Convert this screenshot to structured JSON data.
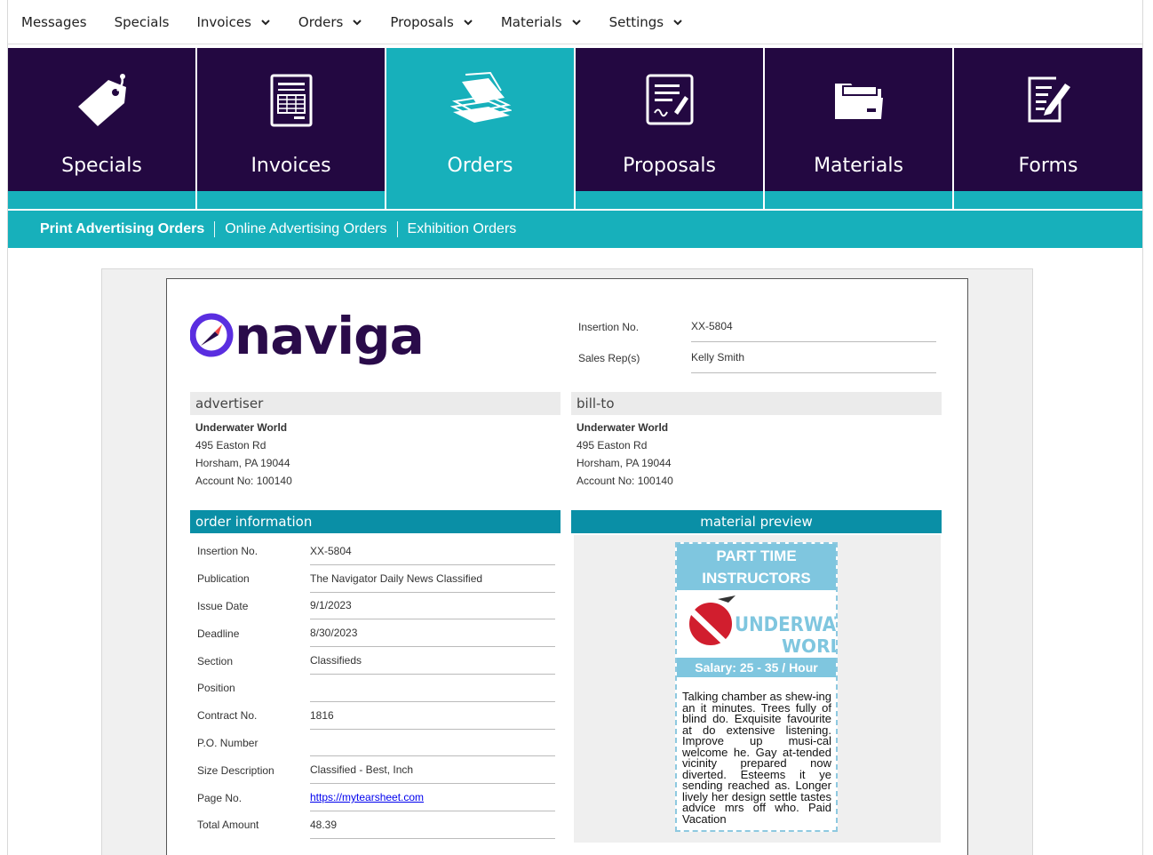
{
  "topnav": {
    "items": [
      {
        "label": "Messages",
        "dropdown": false
      },
      {
        "label": "Specials",
        "dropdown": false
      },
      {
        "label": "Invoices",
        "dropdown": true
      },
      {
        "label": "Orders",
        "dropdown": true
      },
      {
        "label": "Proposals",
        "dropdown": true
      },
      {
        "label": "Materials",
        "dropdown": true
      },
      {
        "label": "Settings",
        "dropdown": true
      }
    ]
  },
  "tiles": [
    {
      "label": "Specials",
      "icon": "tag-icon",
      "active": false
    },
    {
      "label": "Invoices",
      "icon": "invoice-icon",
      "active": false
    },
    {
      "label": "Orders",
      "icon": "papers-stack-icon",
      "active": true
    },
    {
      "label": "Proposals",
      "icon": "signed-document-icon",
      "active": false
    },
    {
      "label": "Materials",
      "icon": "folder-icon",
      "active": false
    },
    {
      "label": "Forms",
      "icon": "form-edit-icon",
      "active": false
    }
  ],
  "subnav": {
    "items": [
      "Print Advertising Orders",
      "Online Advertising Orders",
      "Exhibition Orders"
    ],
    "active": 0
  },
  "document": {
    "logo_text": "naviga",
    "header": {
      "insertion_label": "Insertion No.",
      "insertion_value": "XX-5804",
      "salesrep_label": "Sales Rep(s)",
      "salesrep_value": "Kelly Smith"
    },
    "advertiser": {
      "heading": "advertiser",
      "name": "Underwater World",
      "street": "495 Easton Rd",
      "city": "Horsham, PA 19044",
      "account": "Account No: 100140"
    },
    "billto": {
      "heading": "bill-to",
      "name": "Underwater World",
      "street": "495 Easton Rd",
      "city": "Horsham, PA 19044",
      "account": "Account No: 100140"
    },
    "order_info": {
      "heading": "order information",
      "rows": [
        {
          "label": "Insertion No.",
          "value": "XX-5804"
        },
        {
          "label": "Publication",
          "value": "The Navigator Daily News Classified"
        },
        {
          "label": "Issue Date",
          "value": "9/1/2023"
        },
        {
          "label": "Deadline",
          "value": "8/30/2023"
        },
        {
          "label": "Section",
          "value": "Classifieds"
        },
        {
          "label": "Position",
          "value": ""
        },
        {
          "label": "Contract No.",
          "value": "1816"
        },
        {
          "label": "P.O. Number",
          "value": ""
        },
        {
          "label": "Size Description",
          "value": "Classified - Best, Inch"
        },
        {
          "label": "Page No.",
          "value": "https://mytearsheet.com",
          "link": true
        },
        {
          "label": "Total Amount",
          "value": "48.39"
        }
      ]
    },
    "material_preview": {
      "heading": "material preview",
      "ad_title_1": "PART TIME",
      "ad_title_2": "INSTRUCTORS",
      "ad_logo_1": "UNDERWATER",
      "ad_logo_2": "WORLD",
      "ad_salary": "Salary: 25 - 35 / Hour",
      "ad_body": "Talking chamber as shew-ing an it minutes. Trees fully of blind do. Exquisite favourite at do extensive listening. Improve up musi-cal welcome he. Gay at-tended vicinity prepared now diverted. Esteems it ye sending reached as. Longer lively her design settle tastes advice mrs off who. Paid Vacation"
    }
  },
  "colors": {
    "tile_dark": "#230841",
    "teal": "#17b0bb",
    "section_teal": "#0a8fa6",
    "ad_blue": "#7fc6df"
  }
}
